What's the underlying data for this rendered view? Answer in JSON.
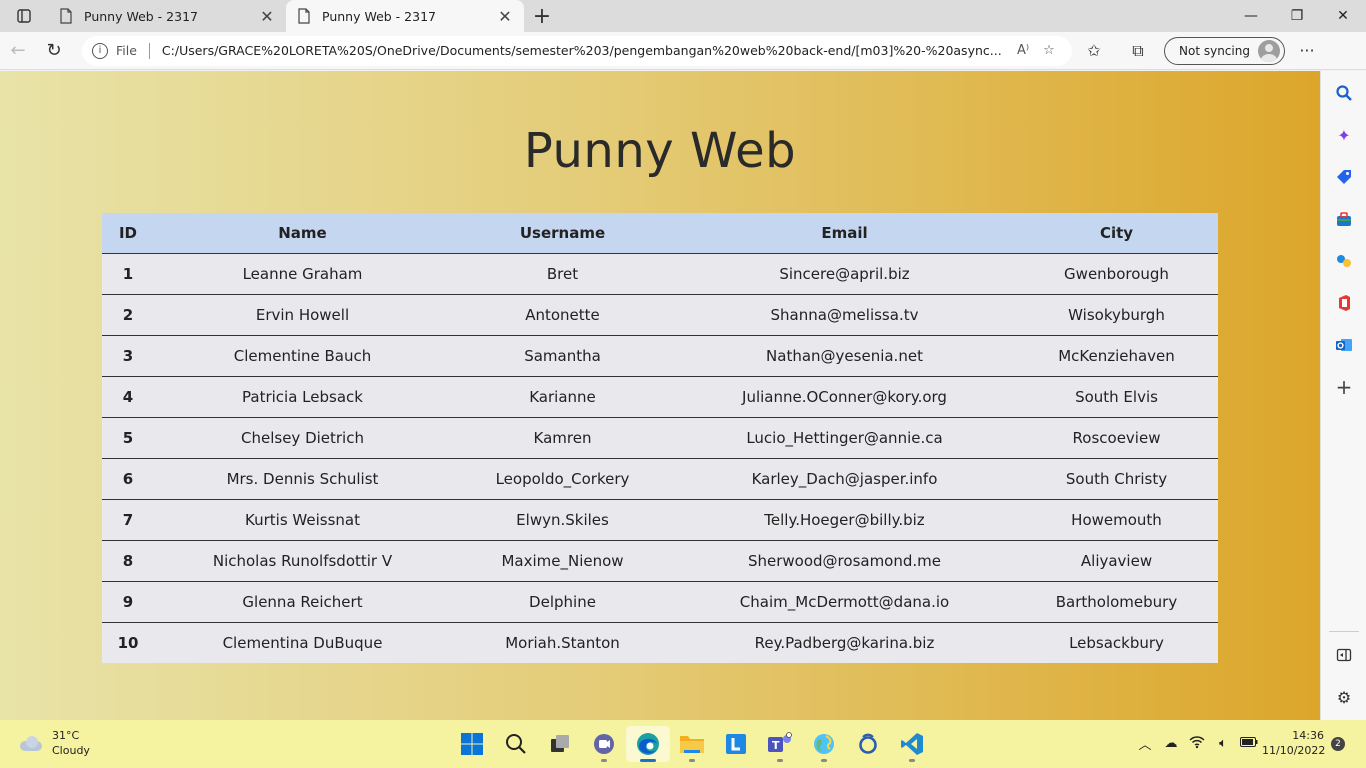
{
  "browser": {
    "tabs": [
      {
        "title": "Punny Web - 2317",
        "active": false
      },
      {
        "title": "Punny Web - 2317",
        "active": true
      }
    ],
    "address": {
      "scheme_label": "File",
      "url": "C:/Users/GRACE%20LORETA%20S/OneDrive/Documents/semester%203/pengembangan%20web%20back-end/[m03]%20-%20async..."
    },
    "profile_label": "Not syncing"
  },
  "page": {
    "title": "Punny Web",
    "table": {
      "headers": [
        "ID",
        "Name",
        "Username",
        "Email",
        "City"
      ],
      "rows": [
        [
          "1",
          "Leanne Graham",
          "Bret",
          "Sincere@april.biz",
          "Gwenborough"
        ],
        [
          "2",
          "Ervin Howell",
          "Antonette",
          "Shanna@melissa.tv",
          "Wisokyburgh"
        ],
        [
          "3",
          "Clementine Bauch",
          "Samantha",
          "Nathan@yesenia.net",
          "McKenziehaven"
        ],
        [
          "4",
          "Patricia Lebsack",
          "Karianne",
          "Julianne.OConner@kory.org",
          "South Elvis"
        ],
        [
          "5",
          "Chelsey Dietrich",
          "Kamren",
          "Lucio_Hettinger@annie.ca",
          "Roscoeview"
        ],
        [
          "6",
          "Mrs. Dennis Schulist",
          "Leopoldo_Corkery",
          "Karley_Dach@jasper.info",
          "South Christy"
        ],
        [
          "7",
          "Kurtis Weissnat",
          "Elwyn.Skiles",
          "Telly.Hoeger@billy.biz",
          "Howemouth"
        ],
        [
          "8",
          "Nicholas Runolfsdottir V",
          "Maxime_Nienow",
          "Sherwood@rosamond.me",
          "Aliyaview"
        ],
        [
          "9",
          "Glenna Reichert",
          "Delphine",
          "Chaim_McDermott@dana.io",
          "Bartholomebury"
        ],
        [
          "10",
          "Clementina DuBuque",
          "Moriah.Stanton",
          "Rey.Padberg@karina.biz",
          "Lebsackbury"
        ]
      ]
    }
  },
  "taskbar": {
    "weather_temp": "31°C",
    "weather_desc": "Cloudy",
    "time": "14:36",
    "date": "11/10/2022",
    "notification_count": "2"
  },
  "colors": {
    "header_row": "#c5d6f0",
    "body_row": "#e9e9ed",
    "gradient_end": "#dca62a",
    "taskbar": "#f6f3a0"
  }
}
